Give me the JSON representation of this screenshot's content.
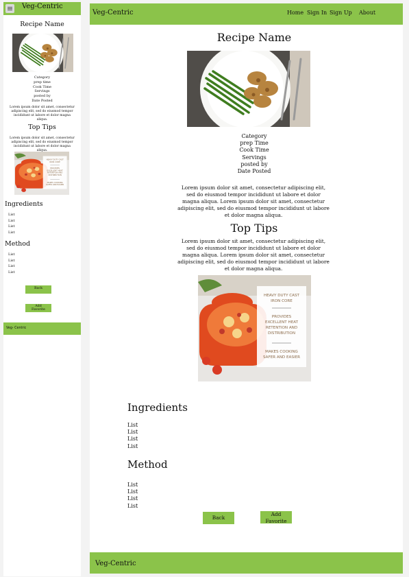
{
  "brand": "Veg-Centric",
  "nav": {
    "home": "Home",
    "sign_in": "Sign In",
    "sign_up": "Sign Up",
    "about": "About"
  },
  "recipe": {
    "title": "Recipe Name",
    "category": "Category",
    "prep_time": "prep Time",
    "prep_time_mobile": "prep time",
    "cook_time": "Cook Time",
    "servings": "Servings",
    "posted_by": "posted by",
    "date_posted": "Date Posted",
    "description": "Lorem ipsum dolor sit amet, consectetur adipiscing elit, sed do eiusmod tempor incididunt ut labore et dolor magna aliqua. Lorem ipsum dolor sit amet, consectetur adipiscing elit, sed do eiusmod tempor incididunt ut labore et dolor magna aliqua.",
    "description_mobile": "Lorem ipsum dolor sit amet, consectetur adipiscing elit, sed do eiusmod tempor incididunt ut labore et dolor magna aliqua."
  },
  "tips": {
    "heading": "Top Tips",
    "text": "Lorem ipsum dolor sit amet, consectetur adipiscing elit, sed do eiusmod tempor incididunt ut labore et dolor magna aliqua. Lorem ipsum dolor sit amet, consectetur adipiscing elit, sed do eiusmod tempor incididunt ut labore et dolor magna aliqua.",
    "text_mobile": "Lorem ipsum dolor sit amet, consectetur adipiscing elit, sed do eiusmod tempor incididunt ut labore et dolor magna aliqua.",
    "image_text": [
      "HEAVY DUTY CAST IRON CORE",
      "PROVIDES EXCELLENT HEAT RETENTION AND DISTRIBUTION",
      "MAKES COOKING SAFER AND EASIER"
    ]
  },
  "ingredients": {
    "heading": "Ingredients",
    "items": [
      "List",
      "List",
      "List",
      "List"
    ]
  },
  "method": {
    "heading": "Method",
    "items": [
      "List",
      "List",
      "List",
      "List"
    ]
  },
  "buttons": {
    "back": "Back",
    "add_favorite": "Add Favorite",
    "add_favorite_mobile_line1": "Add",
    "add_favorite_mobile_line2": "Favorite"
  },
  "footer": {
    "brand": "Veg-Centric",
    "brand_mobile": "Veg- Centric"
  },
  "colors": {
    "accent": "#8bc34a",
    "page_bg": "#f3f3f3"
  },
  "icons": {
    "menu": "hamburger-menu-icon"
  }
}
